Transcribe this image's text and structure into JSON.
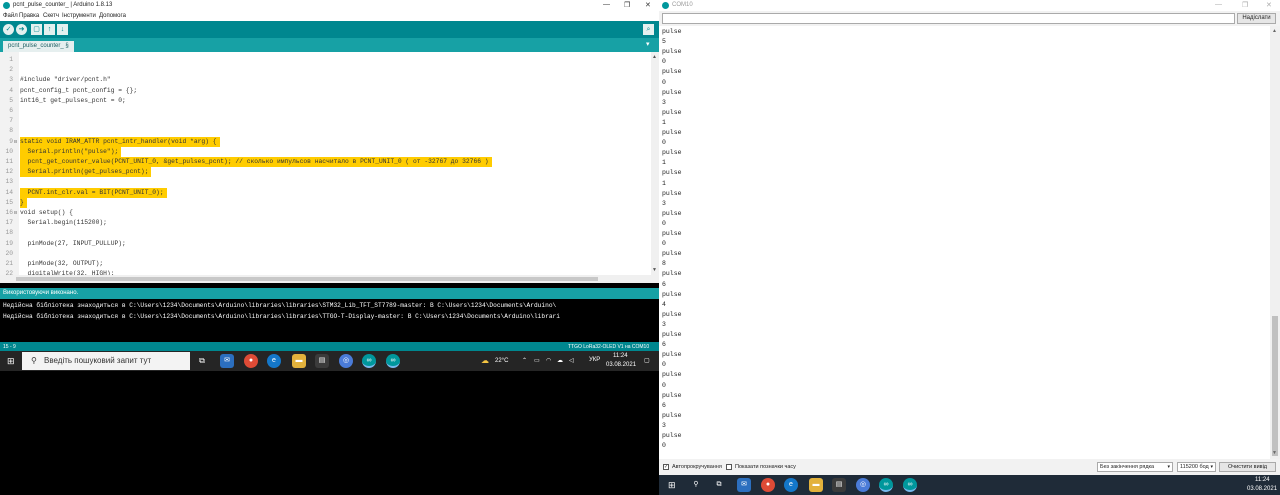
{
  "ide": {
    "title": "pcnt_pulse_counter_ | Arduino 1.8.13",
    "menu": [
      "Файл",
      "Правка",
      "Скетч",
      "Інструменти",
      "Допомога"
    ],
    "tab_label": "pcnt_pulse_counter_ §",
    "code": [
      {
        "n": "1",
        "text": "",
        "hl": false
      },
      {
        "n": "2",
        "text": "",
        "hl": false
      },
      {
        "n": "3",
        "text": "#include \"driver/pcnt.h\"",
        "hl": false
      },
      {
        "n": "4",
        "text": "pcnt_config_t pcnt_config = {};",
        "hl": false
      },
      {
        "n": "5",
        "text": "int16_t get_pulses_pcnt = 0;",
        "hl": false
      },
      {
        "n": "6",
        "text": "",
        "hl": false
      },
      {
        "n": "7",
        "text": "",
        "hl": false
      },
      {
        "n": "8",
        "text": "",
        "hl": false
      },
      {
        "n": "9",
        "text": "static void IRAM_ATTR pcnt_intr_handler(void *arg) {",
        "hl": true,
        "fold": true
      },
      {
        "n": "10",
        "text": "  Serial.println(\"pulse\");",
        "hl": true
      },
      {
        "n": "11",
        "text": "  pcnt_get_counter_value(PCNT_UNIT_0, &get_pulses_pcnt); // сколько импульсов насчитало в PCNT_UNIT_0 ( от -32767 до 32766 )",
        "hl": true
      },
      {
        "n": "12",
        "text": "  Serial.println(get_pulses_pcnt);",
        "hl": true
      },
      {
        "n": "13",
        "text": "",
        "hl": true
      },
      {
        "n": "14",
        "text": "  PCNT.int_clr.val = BIT(PCNT_UNIT_0);",
        "hl": true
      },
      {
        "n": "15",
        "text": "}",
        "hl": true
      },
      {
        "n": "16",
        "text": "void setup() {",
        "hl": false,
        "fold": true
      },
      {
        "n": "17",
        "text": "  Serial.begin(115200);",
        "hl": false
      },
      {
        "n": "18",
        "text": "",
        "hl": false
      },
      {
        "n": "19",
        "text": "  pinMode(27, INPUT_PULLUP);",
        "hl": false
      },
      {
        "n": "20",
        "text": "",
        "hl": false
      },
      {
        "n": "21",
        "text": "  pinMode(32, OUTPUT);",
        "hl": false
      },
      {
        "n": "22",
        "text": "  digitalWrite(32, HIGH);",
        "hl": false
      }
    ],
    "status": "Використовуючи виконано.",
    "console": [
      "Недійсна бібліотека знаходиться в C:\\Users\\1234\\Documents\\Arduino\\libraries\\libraries\\STM32_Lib_TFT_ST7789-master: В C:\\Users\\1234\\Documents\\Arduino\\",
      "Недійсна бібліотека знаходиться в C:\\Users\\1234\\Documents\\Arduino\\libraries\\libraries\\TTGO-T-Display-master: В C:\\Users\\1234\\Documents\\Arduino\\librari"
    ],
    "footer_left": "15 - 9",
    "footer_right": "TTGO LoRa32-OLED V1 на COM10"
  },
  "taskbar_left": {
    "search_placeholder": "Введіть пошуковий запит тут",
    "weather": "22°C",
    "lang": "УКР",
    "time": "11:24",
    "date": "03.08.2021"
  },
  "serial": {
    "title": "COM10",
    "send_label": "Надіслати",
    "output": [
      "pulse",
      "5",
      "pulse",
      "0",
      "pulse",
      "0",
      "pulse",
      "3",
      "pulse",
      "1",
      "pulse",
      "0",
      "pulse",
      "1",
      "pulse",
      "1",
      "pulse",
      "3",
      "pulse",
      "0",
      "pulse",
      "0",
      "pulse",
      "8",
      "pulse",
      "6",
      "pulse",
      "4",
      "pulse",
      "3",
      "pulse",
      "6",
      "pulse",
      "0",
      "pulse",
      "0",
      "pulse",
      "6",
      "pulse",
      "3",
      "pulse",
      "0"
    ],
    "autoscroll_label": "Автопрокручування",
    "timestamp_label": "Показати позначки часу",
    "line_ending": "Без закінчення рядка",
    "baud": "115200 бод",
    "clear_label": "Очистити вивід"
  },
  "taskbar_right": {
    "time": "11:24",
    "date": "03.08.2021"
  },
  "colors": {
    "arduino_teal": "#00878f",
    "arduino_tab_bar": "#17a1a5",
    "highlight": "#ffcc00"
  }
}
